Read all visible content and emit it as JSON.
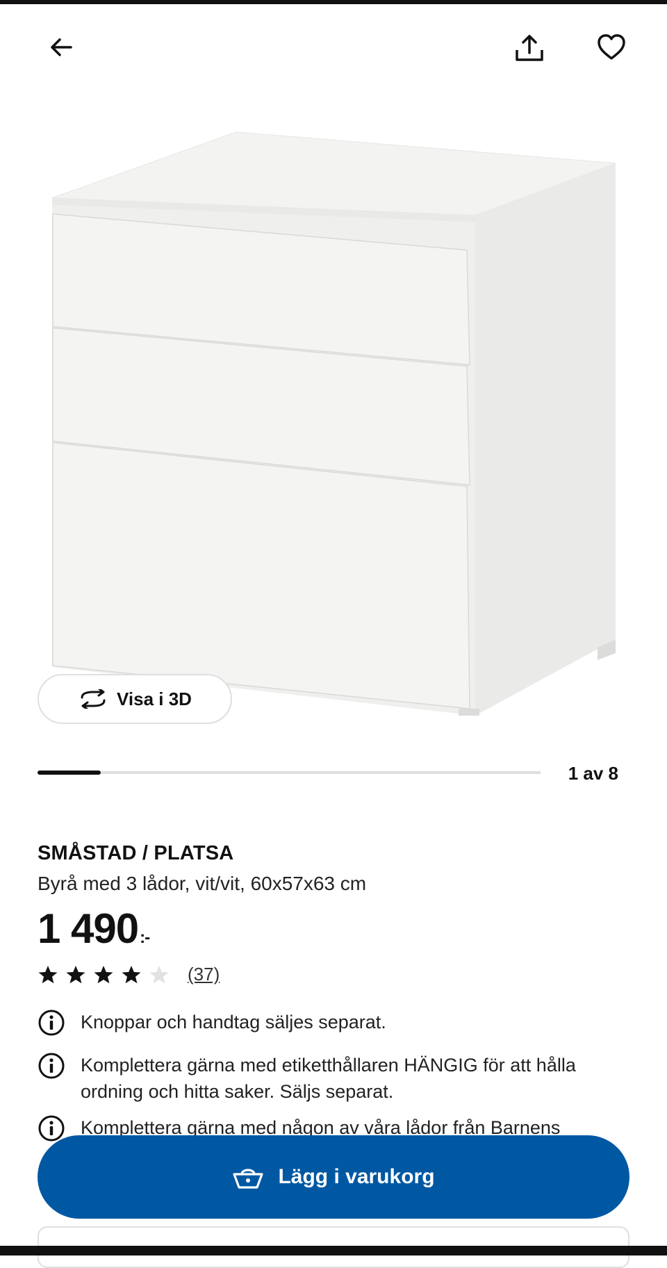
{
  "nav": {
    "back_icon": "arrow-left-icon",
    "share_icon": "share-icon",
    "favorite_icon": "heart-icon"
  },
  "gallery": {
    "view_3d_label": "Visa i 3D",
    "view_3d_icon": "rotate-3d-icon",
    "current_image": 1,
    "total_images": 8,
    "counter_text": "1 av 8",
    "progress_fraction": 0.125
  },
  "product": {
    "name": "SMÅSTAD / PLATSA",
    "description": "Byrå med 3 lådor, vit/vit, 60x57x63 cm",
    "price": "1 490",
    "price_suffix": ":-",
    "rating": 4,
    "rating_max": 5,
    "review_count": "(37)"
  },
  "info_notes": [
    {
      "icon": "info-icon",
      "text": "Knoppar och handtag säljes separat."
    },
    {
      "icon": "info-icon",
      "text": "Komplettera gärna med etiketthållaren HÄNGIG för att hålla ordning och hitta saker. Säljs separat."
    },
    {
      "icon": "info-icon",
      "text": "Komplettera gärna med någon av våra lådor från Barnens"
    }
  ],
  "cart_button": {
    "label": "Lägg i varukorg",
    "icon": "basket-icon",
    "color": "#0058a3"
  }
}
